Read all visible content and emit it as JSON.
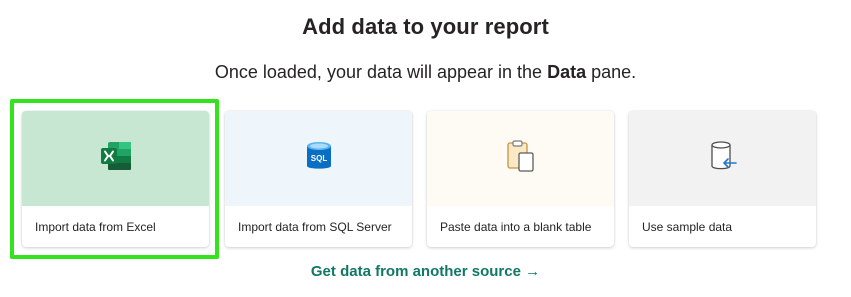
{
  "header": {
    "title": "Add data to your report",
    "subtitle_before": "Once loaded, your data will appear in the ",
    "subtitle_bold": "Data",
    "subtitle_after": " pane."
  },
  "cards": [
    {
      "label": "Import data from Excel",
      "icon": "excel-icon",
      "selected": true,
      "accent": "#c7e7d3"
    },
    {
      "label": "Import data from SQL Server",
      "icon": "sql-server-icon",
      "selected": false,
      "accent": "#eef5fb"
    },
    {
      "label": "Paste data into a blank table",
      "icon": "clipboard-paste-icon",
      "selected": false,
      "accent": "#fdfbf3"
    },
    {
      "label": "Use sample data",
      "icon": "database-arrow-icon",
      "selected": false,
      "accent": "#f2f2f2"
    }
  ],
  "highlight_color": "#33e31b",
  "other_source_link": "Get data from another source →",
  "link_color": "#117865"
}
